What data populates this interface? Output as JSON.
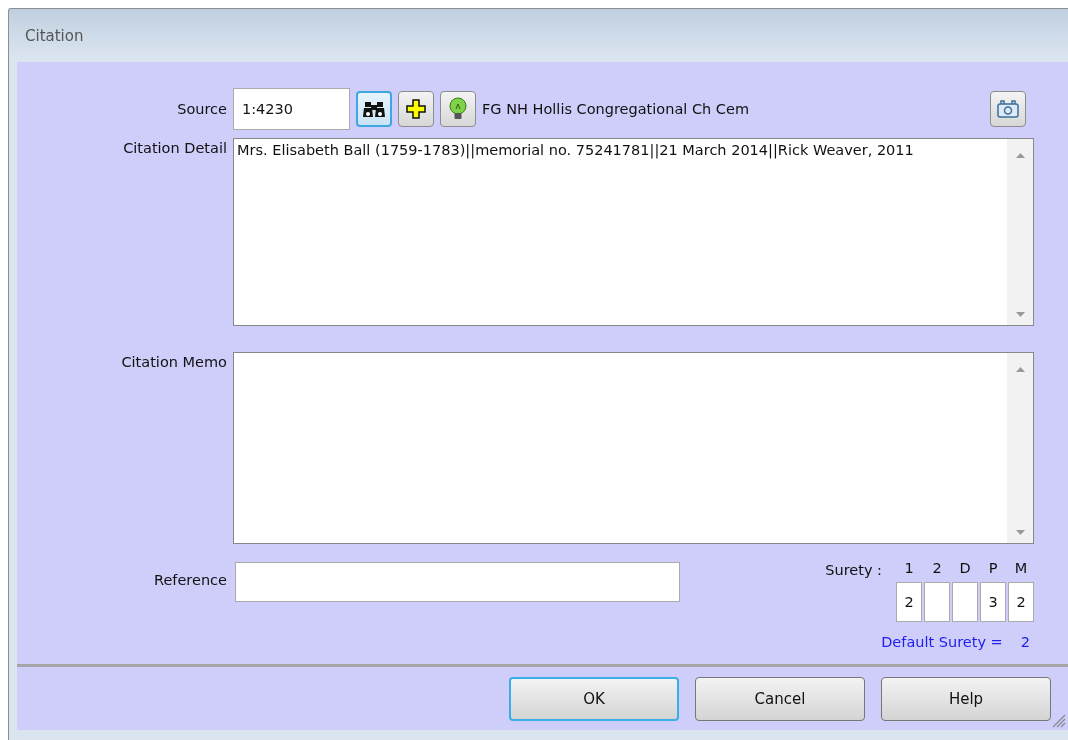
{
  "window": {
    "title": "Citation"
  },
  "source": {
    "label": "Source",
    "value": "1:4230",
    "name": "FG NH Hollis Congregational Ch Cem",
    "tools": [
      {
        "kind": "find",
        "focused": true
      },
      {
        "kind": "add",
        "focused": false
      },
      {
        "kind": "idea",
        "focused": false
      }
    ]
  },
  "citation_detail": {
    "label": "Citation Detail",
    "value": "Mrs. Elisabeth Ball (1759-1783)||memorial no. 75241781||21 March 2014||Rick Weaver, 2011"
  },
  "citation_memo": {
    "label": "Citation Memo"
  },
  "reference": {
    "label": "Reference"
  },
  "surety": {
    "label": "Surety :",
    "fields": [
      {
        "label": "1",
        "value": "2"
      },
      {
        "label": "2"
      },
      {
        "label": "D"
      },
      {
        "label": "P",
        "value": "3"
      },
      {
        "label": "M",
        "value": "2"
      }
    ],
    "default_label": "Default Surety =",
    "default_value": "2"
  },
  "buttons": [
    {
      "label": "OK",
      "focused": true
    },
    {
      "label": "Cancel",
      "focused": false
    },
    {
      "label": "Help",
      "focused": false
    }
  ]
}
